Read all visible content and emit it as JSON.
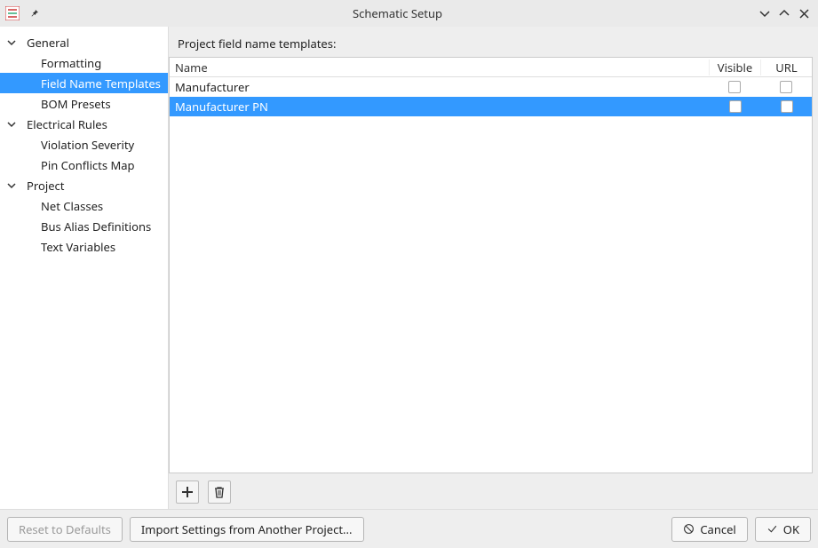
{
  "window": {
    "title": "Schematic Setup"
  },
  "sidebar": {
    "groups": [
      {
        "label": "General",
        "expanded": true,
        "items": [
          {
            "label": "Formatting",
            "selected": false
          },
          {
            "label": "Field Name Templates",
            "selected": true
          },
          {
            "label": "BOM Presets",
            "selected": false
          }
        ]
      },
      {
        "label": "Electrical Rules",
        "expanded": true,
        "items": [
          {
            "label": "Violation Severity",
            "selected": false
          },
          {
            "label": "Pin Conflicts Map",
            "selected": false
          }
        ]
      },
      {
        "label": "Project",
        "expanded": true,
        "items": [
          {
            "label": "Net Classes",
            "selected": false
          },
          {
            "label": "Bus Alias Definitions",
            "selected": false
          },
          {
            "label": "Text Variables",
            "selected": false
          }
        ]
      }
    ]
  },
  "main": {
    "section_label": "Project field name templates:",
    "columns": {
      "name": "Name",
      "visible": "Visible",
      "url": "URL"
    },
    "rows": [
      {
        "name": "Manufacturer",
        "visible": false,
        "url": false,
        "selected": false
      },
      {
        "name": "Manufacturer PN",
        "visible": false,
        "url": false,
        "selected": true
      }
    ]
  },
  "buttons": {
    "reset": "Reset to Defaults",
    "import": "Import Settings from Another Project...",
    "cancel": "Cancel",
    "ok": "OK"
  }
}
